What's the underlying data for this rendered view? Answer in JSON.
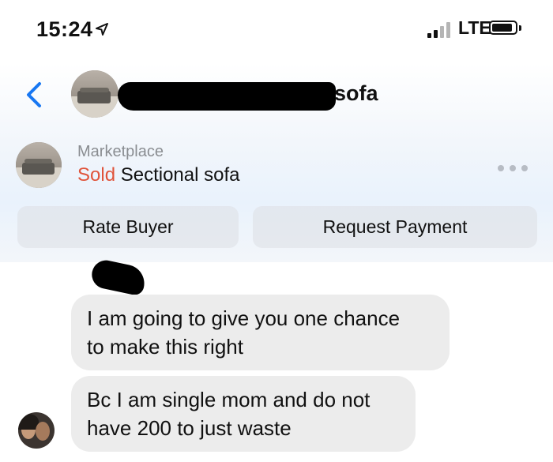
{
  "status_bar": {
    "time": "15:24",
    "network": "LTE",
    "icons": [
      "location-arrow-icon",
      "signal-bars-icon",
      "battery-icon"
    ]
  },
  "header": {
    "back_icon": "chevron-left-icon",
    "title_visible": "sofa",
    "title_redacted": true
  },
  "listing": {
    "subtitle": "Marketplace",
    "status": "Sold",
    "name": "Sectional sofa",
    "more_icon": "ellipsis-icon"
  },
  "actions": {
    "rate_buyer": "Rate Buyer",
    "request_payment": "Request Payment"
  },
  "messages": [
    {
      "text_lines": [
        "I am going to give you one chance",
        "to make this right"
      ]
    },
    {
      "text_lines": [
        "Bc I am single mom and do not",
        "have 200 to just waste"
      ]
    }
  ],
  "colors": {
    "sold": "#e0543b",
    "accent": "#1877f2",
    "bubble": "#ececec",
    "muted_text": "#8a8d91"
  }
}
